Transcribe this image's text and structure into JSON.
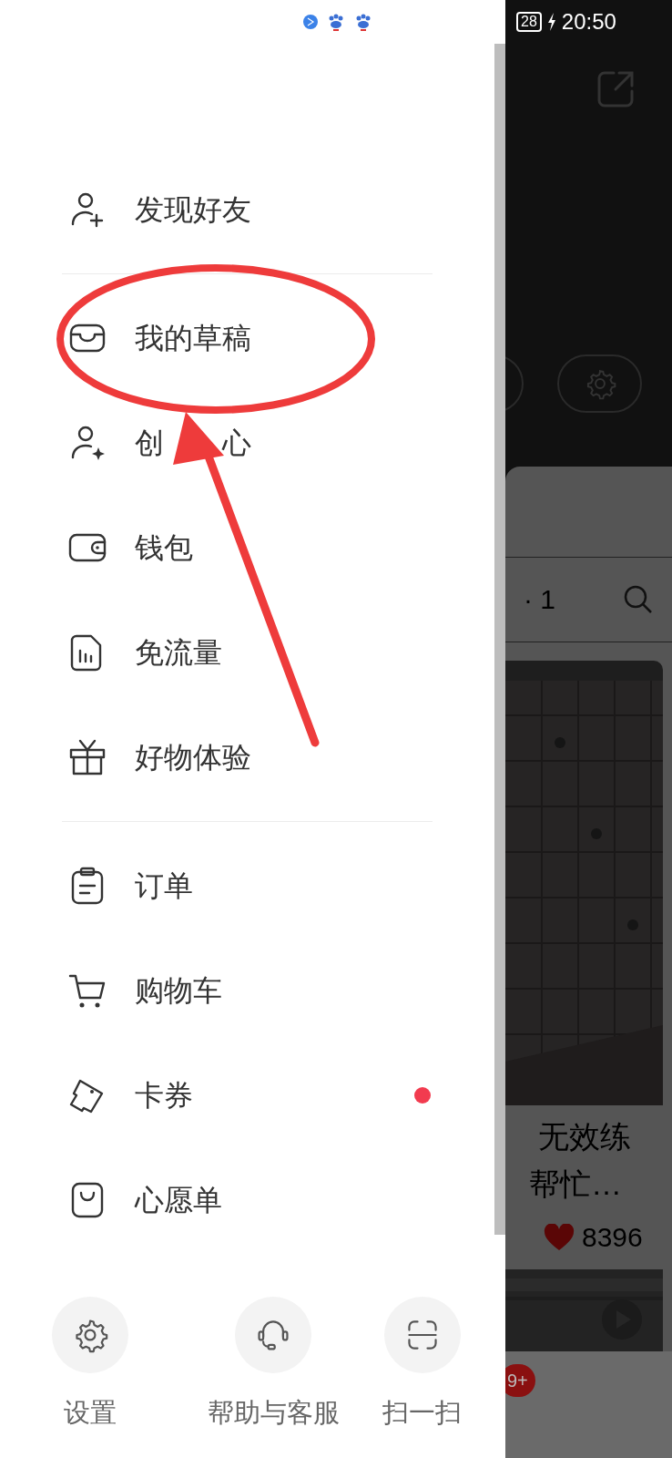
{
  "status_bar": {
    "battery": "28",
    "time": "20:50"
  },
  "drawer": {
    "sections": [
      [
        {
          "kind": "add-user",
          "label": "发现好友"
        }
      ],
      [
        {
          "kind": "inbox",
          "label": "我的草稿"
        },
        {
          "kind": "creator",
          "label": "创",
          "label_end": "心"
        },
        {
          "kind": "wallet",
          "label": "钱包"
        },
        {
          "kind": "data",
          "label": "免流量"
        },
        {
          "kind": "gift",
          "label": "好物体验"
        }
      ],
      [
        {
          "kind": "order",
          "label": "订单"
        },
        {
          "kind": "cart",
          "label": "购物车"
        },
        {
          "kind": "ticket",
          "label": "卡券",
          "dot": {
            "color": "#f23b4f"
          }
        },
        {
          "kind": "bag",
          "label": "心愿单"
        }
      ]
    ]
  },
  "bottom_actions": [
    {
      "kind": "gear",
      "label": "设置"
    },
    {
      "kind": "headset",
      "label": "帮助与客服"
    },
    {
      "kind": "scan",
      "label": "扫一扫"
    }
  ],
  "background_app": {
    "search_count": "· 1",
    "post_title_lines": [
      "无效练",
      "帮忙…"
    ],
    "likes": "8396",
    "nav_badge": "9+"
  }
}
